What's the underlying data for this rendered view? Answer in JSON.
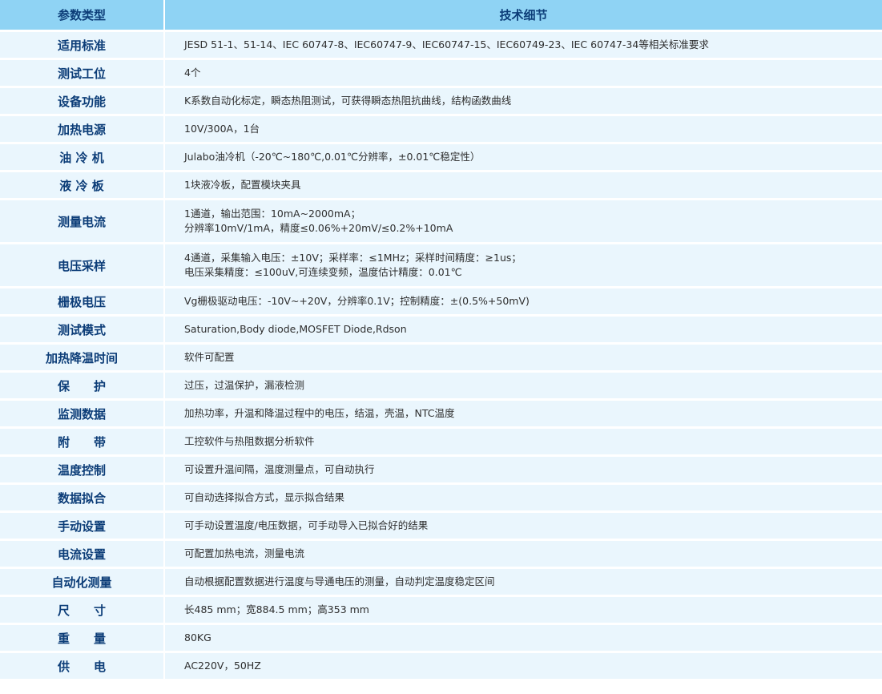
{
  "header": {
    "col_param": "参数类型",
    "col_detail": "技术细节"
  },
  "rows": [
    {
      "param": "适用标准",
      "detail": [
        "JESD 51-1、51-14、IEC 60747-8、IEC60747-9、IEC60747-15、IEC60749-23、IEC 60747-34等相关标准要求"
      ]
    },
    {
      "param": "测试工位",
      "detail": [
        "4个"
      ]
    },
    {
      "param": "设备功能",
      "detail": [
        "K系数自动化标定，瞬态热阻测试，可获得瞬态热阻抗曲线，结构函数曲线"
      ]
    },
    {
      "param": "加热电源",
      "detail": [
        "10V/300A，1台"
      ]
    },
    {
      "param": "油 冷 机",
      "detail": [
        "Julabo油冷机（-20℃~180℃,0.01℃分辨率，±0.01℃稳定性）"
      ]
    },
    {
      "param": "液 冷 板",
      "detail": [
        "1块液冷板，配置模块夹具"
      ]
    },
    {
      "param": "测量电流",
      "detail": [
        "1通道，输出范围：10mA~2000mA；",
        "分辨率10mV/1mA，精度≤0.06%+20mV/≤0.2%+10mA"
      ]
    },
    {
      "param": "电压采样",
      "detail": [
        "4通道，采集输入电压：±10V；采样率：≤1MHz；采样时间精度：≥1us；",
        "电压采集精度：≤100uV,可连续变频，温度估计精度：0.01℃"
      ]
    },
    {
      "param": "栅极电压",
      "detail": [
        "Vg栅极驱动电压：-10V~+20V，分辨率0.1V；控制精度：±(0.5%+50mV)"
      ]
    },
    {
      "param": "测试模式",
      "detail": [
        "Saturation,Body diode,MOSFET Diode,Rdson"
      ]
    },
    {
      "param": "加热降温时间",
      "detail": [
        "软件可配置"
      ]
    },
    {
      "param": "保　　护",
      "detail": [
        "过压，过温保护，漏液检测"
      ]
    },
    {
      "param": "监测数据",
      "detail": [
        "加热功率，升温和降温过程中的电压，结温，壳温，NTC温度"
      ]
    },
    {
      "param": "附　　带",
      "detail": [
        "工控软件与热阻数据分析软件"
      ]
    },
    {
      "param": "温度控制",
      "detail": [
        "可设置升温间隔，温度测量点，可自动执行"
      ]
    },
    {
      "param": "数据拟合",
      "detail": [
        "可自动选择拟合方式，显示拟合结果"
      ]
    },
    {
      "param": "手动设置",
      "detail": [
        "可手动设置温度/电压数据，可手动导入已拟合好的结果"
      ]
    },
    {
      "param": "电流设置",
      "detail": [
        "可配置加热电流，测量电流"
      ]
    },
    {
      "param": "自动化测量",
      "detail": [
        "自动根据配置数据进行温度与导通电压的测量，自动判定温度稳定区间"
      ]
    },
    {
      "param": "尺　　寸",
      "detail": [
        "长485 mm；宽884.5 mm；高353 mm"
      ]
    },
    {
      "param": "重　　量",
      "detail": [
        "80KG"
      ]
    },
    {
      "param": "供　　电",
      "detail": [
        "AC220V，50HZ"
      ]
    }
  ]
}
